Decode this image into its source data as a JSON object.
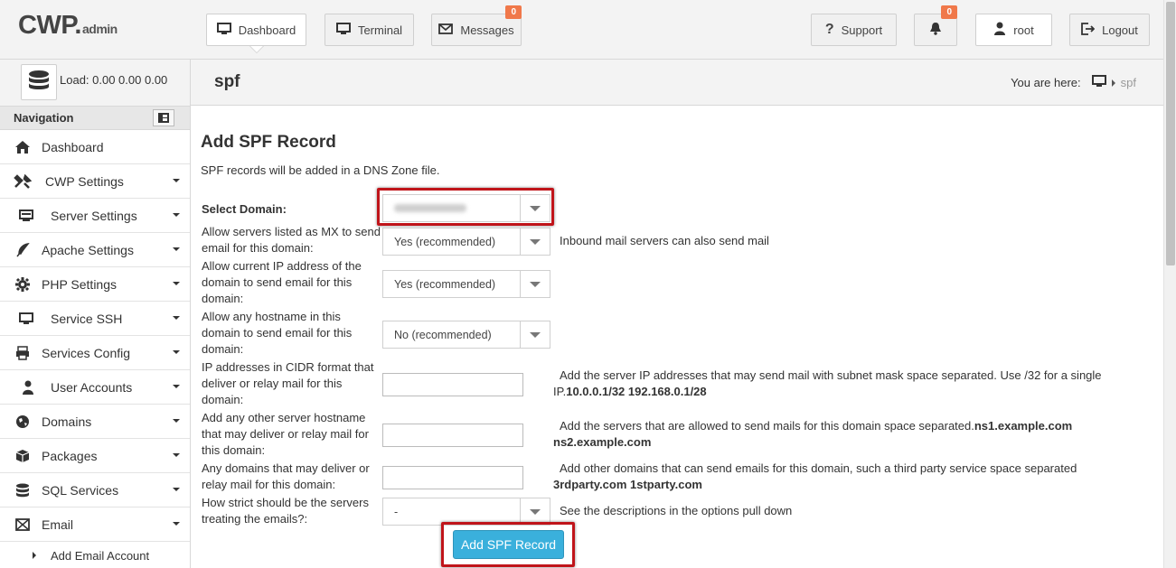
{
  "header": {
    "logo_main": "CWP",
    "logo_sub": "admin",
    "buttons": {
      "dashboard": "Dashboard",
      "terminal": "Terminal",
      "messages": "Messages",
      "messages_badge": "0",
      "support": "Support",
      "notifications_badge": "0",
      "user": "root",
      "logout": "Logout"
    }
  },
  "sidebar": {
    "load_text": "Load: 0.00  0.00  0.00",
    "nav_title": "Navigation",
    "items": [
      {
        "label": "Dashboard",
        "icon": "home-icon"
      },
      {
        "label": "CWP Settings",
        "icon": "tools-icon"
      },
      {
        "label": "Server Settings",
        "icon": "server-icon"
      },
      {
        "label": "Apache Settings",
        "icon": "feather-icon"
      },
      {
        "label": "PHP Settings",
        "icon": "gear-icon"
      },
      {
        "label": "Service SSH",
        "icon": "monitor-icon"
      },
      {
        "label": "Services Config",
        "icon": "printer-icon"
      },
      {
        "label": "User Accounts",
        "icon": "user-icon"
      },
      {
        "label": "Domains",
        "icon": "globe-icon"
      },
      {
        "label": "Packages",
        "icon": "boxes-icon"
      },
      {
        "label": "SQL Services",
        "icon": "database-icon"
      },
      {
        "label": "Email",
        "icon": "envelope-icon"
      }
    ],
    "sub_items": [
      {
        "label": "Add Email Account"
      }
    ]
  },
  "page": {
    "title": "spf",
    "breadcrumb_prefix": "You are here:",
    "breadcrumb_current": "spf"
  },
  "form": {
    "heading": "Add SPF Record",
    "intro": "SPF records will be added in a DNS Zone file.",
    "select_domain_label": "Select Domain:",
    "mx_label": "Allow servers listed as MX to send email for this domain:",
    "mx_value": "Yes (recommended)",
    "mx_help": "Inbound mail servers can also send mail",
    "ip_label": "Allow current IP address of the domain to send email for this domain:",
    "ip_value": "Yes (recommended)",
    "hostname_label": "Allow any hostname in this domain to send email for this domain:",
    "hostname_value": "No (recommended)",
    "cidr_label": "IP addresses in CIDR format that deliver or relay mail for this domain:",
    "cidr_help_text": "Add the server IP addresses that may send mail with subnet mask space separated. Use /32 for a single IP.",
    "cidr_help_example": "10.0.0.1/32 192.168.0.1/28",
    "other_host_label": "Add any other server hostname that may deliver or relay mail for this domain:",
    "other_host_help_text": "Add the servers that are allowed to send mails for this domain space separated.",
    "other_host_help_example1": "ns1.example.com",
    "other_host_help_example2": "ns2.example.com",
    "other_domains_label": "Any domains that may deliver or relay mail for this domain:",
    "other_domains_help_text": "Add other domains that can send emails for this domain, such a third party service space separated",
    "other_domains_help_example": "3rdparty.com 1stparty.com",
    "strict_label": "How strict should be the servers treating the emails?:",
    "strict_value": "-",
    "strict_help": "See the descriptions in the options pull down",
    "submit_label": "Add SPF Record"
  },
  "colors": {
    "highlight_red": "#c0141a",
    "submit_blue": "#3ab0dc",
    "badge_orange": "#f0784a"
  }
}
